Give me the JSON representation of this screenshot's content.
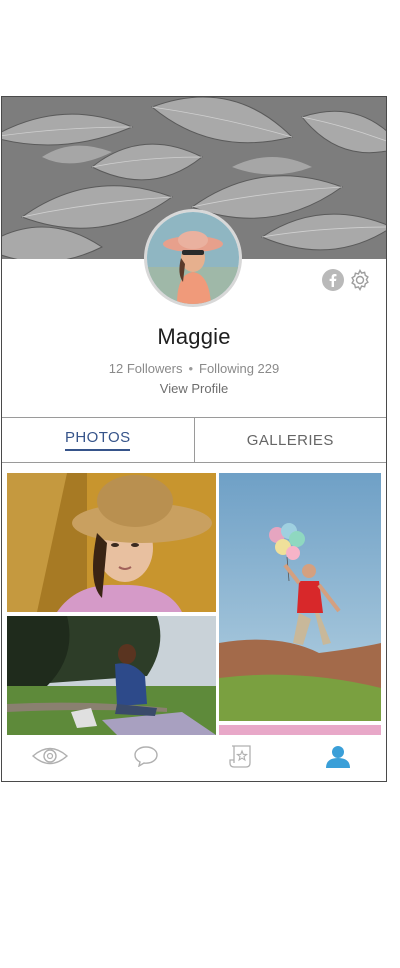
{
  "profile": {
    "name": "Maggie",
    "followers_label": "12 Followers",
    "separator": "•",
    "following_label": "Following 229",
    "view_profile_label": "View Profile"
  },
  "tabs": [
    {
      "label": "PHOTOS",
      "active": true
    },
    {
      "label": "GALLERIES",
      "active": false
    }
  ],
  "header_icons": [
    "facebook-icon",
    "gear-icon"
  ],
  "photos": [
    {
      "subject": "woman-straw-hat"
    },
    {
      "subject": "man-balloons-jump"
    },
    {
      "subject": "woman-sitting-park"
    },
    {
      "subject": "pink-photo-partial"
    }
  ],
  "bottom_nav": [
    {
      "icon": "eye-icon",
      "active": false
    },
    {
      "icon": "chat-bubble-icon",
      "active": false
    },
    {
      "icon": "scroll-star-icon",
      "active": false
    },
    {
      "icon": "profile-icon",
      "active": true
    }
  ],
  "colors": {
    "accent": "#36548a",
    "nav_active": "#3a9fd8",
    "nav_inactive": "#b0b0b0"
  }
}
